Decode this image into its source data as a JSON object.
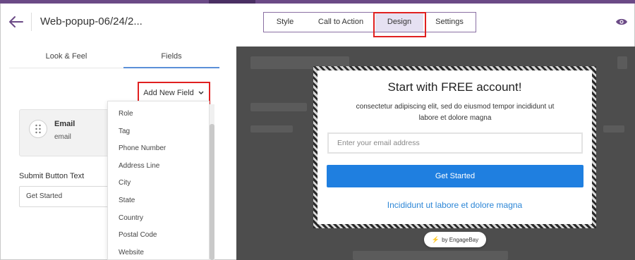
{
  "header": {
    "title": "Web-popup-06/24/2...",
    "back_icon": "arrow-left-icon",
    "preview_icon": "eye-icon",
    "accent_color": "#6b4a86"
  },
  "tabs": [
    {
      "label": "Style",
      "active": false
    },
    {
      "label": "Call to Action",
      "active": false
    },
    {
      "label": "Design",
      "active": true
    },
    {
      "label": "Settings",
      "active": false
    }
  ],
  "left_panel": {
    "tabs": [
      {
        "label": "Look & Feel",
        "active": false
      },
      {
        "label": "Fields",
        "active": true
      }
    ],
    "add_field": {
      "label": "Add New Field",
      "icon": "chevron-down-icon"
    },
    "field_card": {
      "title": "Email",
      "subtitle": "email",
      "icon": "drag-handle-icon"
    },
    "submit_button_text": {
      "label": "Submit Button Text",
      "value": "Get Started"
    },
    "dropdown_items": [
      "Role",
      "Tag",
      "Phone Number",
      "Address Line",
      "City",
      "State",
      "Country",
      "Postal Code",
      "Website"
    ]
  },
  "popup": {
    "title": "Start with FREE account!",
    "description": "consectetur adipiscing elit, sed do eiusmod tempor incididunt ut labore et dolore magna",
    "email_placeholder": "Enter your email address",
    "button_label": "Get Started",
    "button_color": "#1f7fe0",
    "link_text": "Incididunt ut labore et dolore magna",
    "link_color": "#2c86d6"
  },
  "badge": {
    "text": "by EngageBay",
    "icon": "lightning-icon"
  }
}
